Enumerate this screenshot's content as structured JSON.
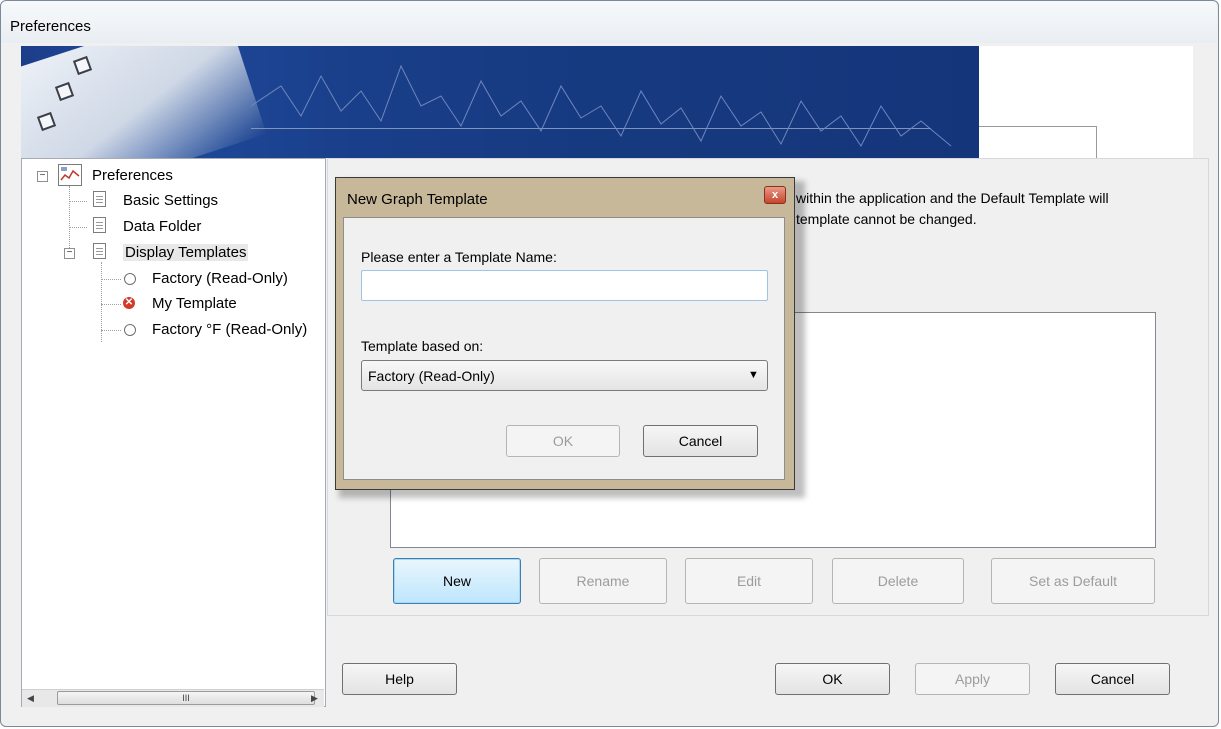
{
  "window": {
    "title": "Preferences"
  },
  "tree": {
    "root": "Preferences",
    "items": [
      {
        "label": "Basic Settings"
      },
      {
        "label": "Data Folder"
      },
      {
        "label": "Display Templates"
      }
    ],
    "templates": [
      {
        "label": "Factory (Read-Only)",
        "marker": "radio-empty"
      },
      {
        "label": "My Template",
        "marker": "radio-x-red"
      },
      {
        "label": "Factory °F (Read-Only)",
        "marker": "radio-empty"
      }
    ]
  },
  "scrollbar": {
    "thumb_grip": "III"
  },
  "templates_page": {
    "description_line1": "within the application and the Default Template will",
    "description_line2": "template cannot be changed.",
    "buttons": {
      "new": "New",
      "rename": "Rename",
      "edit": "Edit",
      "delete": "Delete",
      "set_default": "Set as Default"
    }
  },
  "footer": {
    "help": "Help",
    "ok": "OK",
    "apply": "Apply",
    "cancel": "Cancel"
  },
  "dialog": {
    "title": "New Graph Template",
    "close_glyph": "x",
    "name_label": "Please enter a Template Name:",
    "name_value": "",
    "based_label": "Template based on:",
    "based_value": "Factory (Read-Only)",
    "ok": "OK",
    "cancel": "Cancel"
  },
  "colors": {
    "banner_blue": "#1a3f8a",
    "focus_blue": "#3c7fb1",
    "close_red": "#c7452c"
  }
}
